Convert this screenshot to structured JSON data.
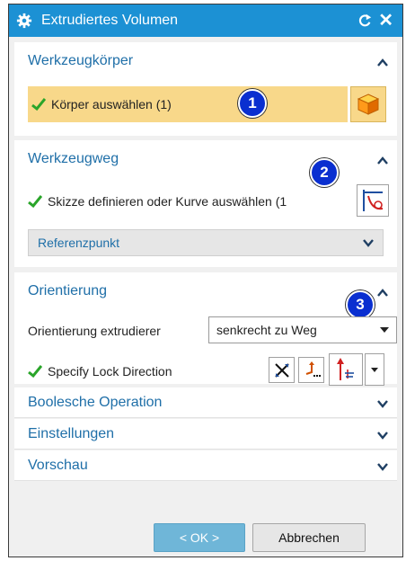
{
  "window": {
    "title": "Extrudiertes Volumen"
  },
  "sections": {
    "werkzeugkoerper": {
      "title": "Werkzeugkörper",
      "select_label": "Körper auswählen (1)",
      "badge": "1"
    },
    "werkzeugweg": {
      "title": "Werkzeugweg",
      "select_label": "Skizze definieren oder Kurve auswählen (1",
      "badge": "2",
      "ref_label": "Referenzpunkt"
    },
    "orientierung": {
      "title": "Orientierung",
      "badge": "3",
      "extrude_label": "Orientierung extrudierer",
      "extrude_value": "senkrecht zu Weg",
      "lock_label": "Specify Lock Direction"
    },
    "boolesche": {
      "title": "Boolesche Operation"
    },
    "einstellungen": {
      "title": "Einstellungen"
    },
    "vorschau": {
      "title": "Vorschau"
    }
  },
  "buttons": {
    "ok": "< OK >",
    "cancel": "Abbrechen"
  },
  "colors": {
    "titlebar": "#1c91d4",
    "accent": "#1f6fa8",
    "highlight": "#f8d88a",
    "badge": "#0a2fd0",
    "ok_button": "#6fb6d8"
  },
  "icons": [
    "gear-icon",
    "reset-icon",
    "close-icon",
    "checkmark-icon",
    "cube-icon",
    "curve-select-icon",
    "cross-arrows-icon",
    "vector-point-icon",
    "direction-arrow-icon",
    "chevron-up-icon",
    "chevron-down-icon"
  ]
}
